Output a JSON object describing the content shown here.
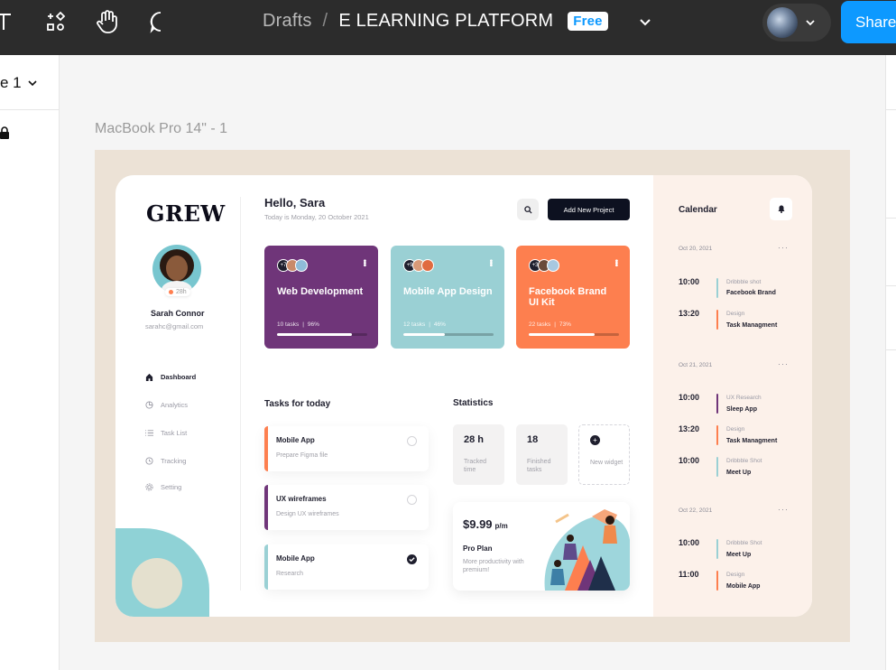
{
  "topbar": {
    "breadcrumb_root": "Drafts",
    "separator": "/",
    "file_title": "E LEARNING PLATFORM",
    "plan_badge": "Free",
    "share_label": "Share",
    "icons": [
      "text-tool-icon",
      "shape-tool-icon",
      "hand-tool-icon",
      "comment-tool-icon",
      "chevron-down-icon"
    ]
  },
  "left_panel": {
    "page_selector": "e 1"
  },
  "canvas": {
    "frame_label": "MacBook Pro 14\" - 1"
  },
  "app": {
    "logo": "GREW",
    "profile": {
      "name": "Sarah Connor",
      "email": "sarahc@gmail.com",
      "hours": "28h"
    },
    "nav": [
      {
        "label": "Dashboard",
        "icon": "home-icon",
        "active": true
      },
      {
        "label": "Analytics",
        "icon": "pie-chart-icon",
        "active": false
      },
      {
        "label": "Task List",
        "icon": "list-icon",
        "active": false
      },
      {
        "label": "Tracking",
        "icon": "clock-icon",
        "active": false
      },
      {
        "label": "Setting",
        "icon": "gear-icon",
        "active": false
      }
    ],
    "header": {
      "greeting": "Hello, Sara",
      "date": "Today is Monday, 20 October 2021",
      "add_button": "Add New Project"
    },
    "projects": [
      {
        "title": "Web Development",
        "count": "+7",
        "tasks": "10 tasks",
        "percent": "96%",
        "progress": 0.83,
        "color": "#6f3579"
      },
      {
        "title": "Mobile App Design",
        "count": "+9",
        "tasks": "12 tasks",
        "percent": "46%",
        "progress": 0.46,
        "color": "#9ad0d4"
      },
      {
        "title": "Facebook Brand UI Kit",
        "count": "+3",
        "tasks": "22 tasks",
        "percent": "73%",
        "progress": 0.73,
        "color": "#fd7f4f"
      }
    ],
    "tasks_title": "Tasks for today",
    "tasks": [
      {
        "title": "Mobile App",
        "subtitle": "Prepare Figma file",
        "color": "#fd7f4f",
        "done": false
      },
      {
        "title": "UX wireframes",
        "subtitle": "Design UX wireframes",
        "color": "#6f3579",
        "done": false
      },
      {
        "title": "Mobile App",
        "subtitle": "Research",
        "color": "#9ad0d4",
        "done": true
      }
    ],
    "stats_title": "Statistics",
    "stats": [
      {
        "value": "28 h",
        "label": "Tracked time"
      },
      {
        "value": "18",
        "label": "Finished tasks"
      },
      {
        "value": "+",
        "label": "New widget"
      }
    ],
    "pro": {
      "price": "$9.99",
      "per": "p/m",
      "plan": "Pro Plan",
      "desc": "More productivity with premium!"
    }
  },
  "calendar": {
    "title": "Calendar",
    "days": [
      {
        "date": "Oct 20, 2021",
        "events": [
          {
            "time": "10:00",
            "category": "Dribbble shot",
            "name": "Facebook Brand",
            "color": "#9ad0d4"
          },
          {
            "time": "13:20",
            "category": "Design",
            "name": "Task Managment",
            "color": "#fd7f4f"
          }
        ]
      },
      {
        "date": "Oct 21, 2021",
        "events": [
          {
            "time": "10:00",
            "category": "UX Research",
            "name": "Sleep App",
            "color": "#6f3579"
          },
          {
            "time": "13:20",
            "category": "Design",
            "name": "Task Managment",
            "color": "#fd7f4f"
          },
          {
            "time": "10:00",
            "category": "Dribbble Shot",
            "name": "Meet Up",
            "color": "#9ad0d4"
          }
        ]
      },
      {
        "date": "Oct 22, 2021",
        "events": [
          {
            "time": "10:00",
            "category": "Dribbble Shot",
            "name": "Meet Up",
            "color": "#9ad0d4"
          },
          {
            "time": "11:00",
            "category": "Design",
            "name": "Mobile App",
            "color": "#fd7f4f"
          }
        ]
      }
    ]
  }
}
